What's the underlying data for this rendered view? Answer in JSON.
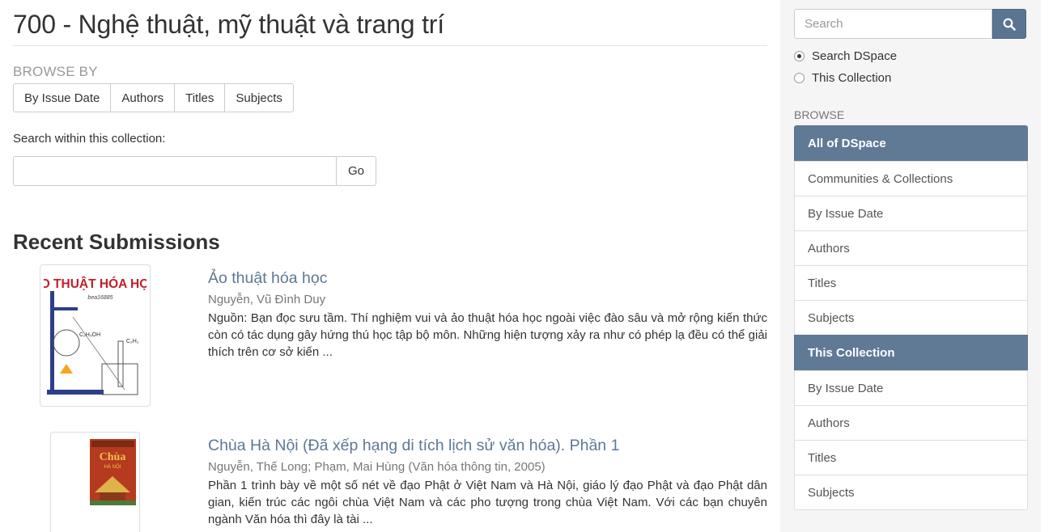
{
  "page": {
    "title": "700 - Nghệ thuật, mỹ thuật và trang trí"
  },
  "browse_by": {
    "label": "BROWSE BY",
    "buttons": [
      "By Issue Date",
      "Authors",
      "Titles",
      "Subjects"
    ]
  },
  "collection_search": {
    "label": "Search within this collection:",
    "value": "",
    "go_label": "Go"
  },
  "recent": {
    "heading": "Recent Submissions",
    "items": [
      {
        "title": "Ảo thuật hóa học",
        "authors": "Nguyễn, Vũ Đình Duy",
        "abstract": "Nguồn: Bạn đọc sưu tầm. Thí nghiệm vui và ảo thuật hóa học ngoài việc đào sâu và mở rộng kiến thức còn có tác dụng gây hứng thú học tập bộ môn. Những hiện tượng xảy ra như có phép lạ đều có thể giải thích trên cơ sở kiến ...",
        "cover_text": "ẢO THUẬT HÓA HỌC",
        "cover_sub": "bea16885"
      },
      {
        "title": "Chùa Hà Nội (Đã xếp hạng di tích lịch sử văn hóa). Phần 1",
        "authors": "Nguyễn, Thế Long; Phạm, Mai Hùng (Văn hóa thông tin, 2005)",
        "abstract": "Phần 1 trình bày về một số nét về đạo Phật ở Việt Nam và Hà Nội, giáo lý đạo Phật và đạo Phật dân gian, kiến trúc các ngôi chùa Việt Nam và các pho tượng trong chùa Việt Nam. Với các bạn chuyên ngành Văn hóa thì đây là tài ...",
        "cover_text": "Chùa",
        "cover_sub": "HÀ NỘI"
      }
    ]
  },
  "sidebar": {
    "search_placeholder": "Search",
    "search_icon": "search-icon",
    "radio_options": [
      {
        "label": "Search DSpace",
        "checked": true
      },
      {
        "label": "This Collection",
        "checked": false
      }
    ],
    "browse_label": "BROWSE",
    "all_header": "All of DSpace",
    "all_items": [
      "Communities & Collections",
      "By Issue Date",
      "Authors",
      "Titles",
      "Subjects"
    ],
    "collection_header": "This Collection",
    "collection_items": [
      "By Issue Date",
      "Authors",
      "Titles",
      "Subjects"
    ]
  },
  "colors": {
    "accent": "#607a96",
    "link": "#5d7896"
  }
}
